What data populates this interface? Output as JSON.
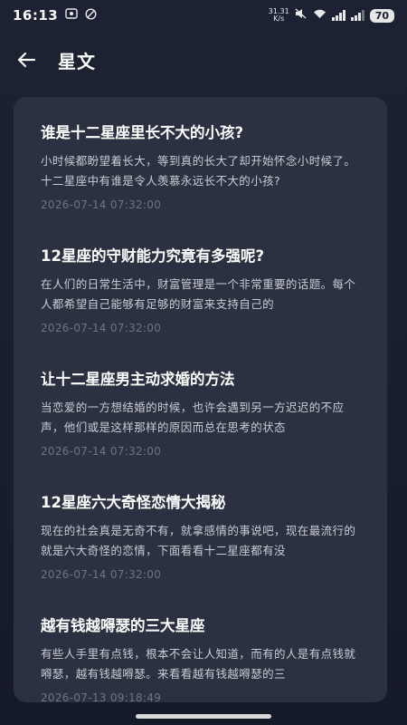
{
  "status": {
    "time": "16:13",
    "net_speed_top": "31.31",
    "net_speed_bottom": "K/s",
    "battery": "70"
  },
  "header": {
    "title": "星文"
  },
  "articles": [
    {
      "title": "谁是十二星座里长不大的小孩?",
      "summary": "小时候都盼望着长大，等到真的长大了却开始怀念小时候了。十二星座中有谁是令人羡慕永远长不大的小孩?",
      "date": "2026-07-14 07:32:00"
    },
    {
      "title": "12星座的守财能力究竟有多强呢?",
      "summary": "在人们的日常生活中，财富管理是一个非常重要的话题。每个人都希望自己能够有足够的财富来支持自己的",
      "date": "2026-07-14 07:32:00"
    },
    {
      "title": "让十二星座男主动求婚的方法",
      "summary": "当恋爱的一方想结婚的时候，也许会遇到另一方迟迟的不应声，他们或是这样那样的原因而总在思考的状态",
      "date": "2026-07-14 07:32:00"
    },
    {
      "title": "12星座六大奇怪恋情大揭秘",
      "summary": "现在的社会真是无奇不有，就拿感情的事说吧，现在最流行的就是六大奇怪的恋情，下面看看十二星座都有没",
      "date": "2026-07-14 07:32:00"
    },
    {
      "title": "越有钱越嘚瑟的三大星座",
      "summary": "有些人手里有点钱，根本不会让人知道，而有的人是有点钱就嘚瑟，越有钱越嘚瑟。来看看越有钱越嘚瑟的三",
      "date": "2026-07-13 09:18:49"
    }
  ]
}
